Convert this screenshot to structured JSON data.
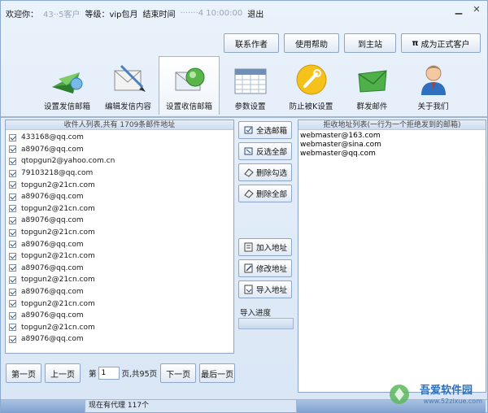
{
  "titlebar": {
    "welcome": "欢迎你：",
    "customer_masked": "43··5客户",
    "level_label": "等级：vip包月",
    "end_label": "结束时间",
    "end_masked": "·······4 10:00:00",
    "logout": "退出"
  },
  "top_actions": {
    "contact": "联系作者",
    "help": "使用帮助",
    "home": "到主站",
    "upgrade": "成为正式客户",
    "upgrade_symbol": "π"
  },
  "toolbar": [
    {
      "label": "设置发信邮箱",
      "icon": "mail-send-icon"
    },
    {
      "label": "编辑发信内容",
      "icon": "mail-edit-icon"
    },
    {
      "label": "设置收信邮箱",
      "icon": "mail-receive-icon"
    },
    {
      "label": "参数设置",
      "icon": "calendar-icon"
    },
    {
      "label": "防止被K设置",
      "icon": "wrench-icon"
    },
    {
      "label": "群发邮件",
      "icon": "envelope-icon"
    },
    {
      "label": "关于我们",
      "icon": "person-icon"
    }
  ],
  "recipients": {
    "header": "收件人列表,共有 1709条邮件地址",
    "items": [
      "433168@qq.com",
      "a89076@qq.com",
      "qtopgun2@yahoo.com.cn",
      "79103218@qq.com",
      "topgun2@21cn.com",
      "a89076@qq.com",
      "topgun2@21cn.com",
      "a89076@qq.com",
      "topgun2@21cn.com",
      "a89076@qq.com",
      "topgun2@21cn.com",
      "a89076@qq.com",
      "topgun2@21cn.com",
      "a89076@qq.com",
      "topgun2@21cn.com",
      "a89076@qq.com",
      "topgun2@21cn.com",
      "a89076@qq.com"
    ]
  },
  "pager": {
    "first": "第一页",
    "prev": "上一页",
    "page_prefix": "第",
    "page_value": "1",
    "page_suffix": "页,共95页",
    "next": "下一页",
    "last": "最后一页"
  },
  "mid_buttons": {
    "select_all": "全选邮箱",
    "invert": "反选全部",
    "delete_checked": "删除勾选",
    "delete_all": "删除全部",
    "add_address": "加入地址",
    "edit_address": "修改地址",
    "import_address": "导入地址",
    "import_progress": "导入进度"
  },
  "reject": {
    "header": "拒收地址列表(一行为一个拒绝发到的邮箱)",
    "content": "webmaster@163.com\nwebmaster@sina.com\nwebmaster@qq.com"
  },
  "status": {
    "proxy": "现在有代理 117个"
  },
  "watermark": {
    "brand": "吾爱软件园",
    "url": "www.52zixue.com"
  },
  "colors": {
    "accent": "#2a6fc0",
    "border": "#8fa7c6"
  }
}
